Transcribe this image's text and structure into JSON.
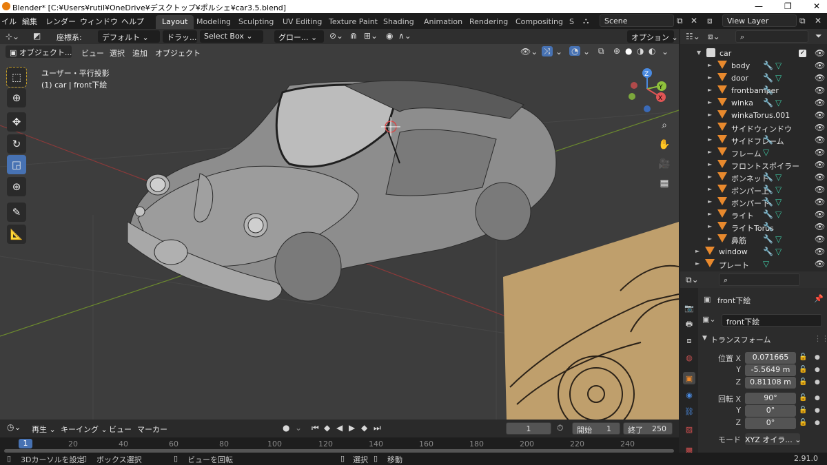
{
  "titlebar": {
    "title": "Blender* [C:¥Users¥rutil¥OneDrive¥デスクトップ¥ポルシェ¥car3.5.blend]"
  },
  "menu": [
    "イル",
    "編集",
    "レンダー",
    "ウィンドウ",
    "ヘルプ"
  ],
  "workspaces": [
    "Layout",
    "Modeling",
    "Sculpting",
    "UV Editing",
    "Texture Paint",
    "Shading",
    "Animation",
    "Rendering",
    "Compositing",
    "S"
  ],
  "scene": {
    "label": "Scene"
  },
  "view_layer": {
    "label": "View Layer"
  },
  "tool_header": {
    "coord_label": "座標系:",
    "orient": "デフォルト",
    "drag": "ドラッ...",
    "select_box": "Select Box",
    "pivot": "グロー...",
    "options": "オプション"
  },
  "viewport_header": {
    "mode": "オブジェクト...",
    "items": [
      "ビュー",
      "選択",
      "追加",
      "オブジェクト"
    ]
  },
  "viewport": {
    "info_line1": "ユーザー・平行投影",
    "info_line2": "(1) car | front下絵"
  },
  "gizmo": {
    "z": "Z",
    "y": "Y",
    "x": "X"
  },
  "outliner": {
    "collection": "car",
    "items": [
      {
        "name": "body",
        "icons": "wv"
      },
      {
        "name": "door",
        "icons": "wv"
      },
      {
        "name": "frontbamper",
        "icons": "w"
      },
      {
        "name": "winka",
        "icons": "wv"
      },
      {
        "name": "winkaTorus.001",
        "icons": ""
      },
      {
        "name": "サイドウィンドウ",
        "icons": ""
      },
      {
        "name": "サイドフレーム",
        "icons": "w"
      },
      {
        "name": "フレーム",
        "icons": "v"
      },
      {
        "name": "フロントスポイラー",
        "icons": ""
      },
      {
        "name": "ボンネット",
        "icons": "wv"
      },
      {
        "name": "ボンパー上",
        "icons": "wv"
      },
      {
        "name": "ボンパー下",
        "icons": "wv"
      },
      {
        "name": "ライト",
        "icons": "wv"
      },
      {
        "name": "ライトTorus",
        "icons": "w"
      },
      {
        "name": "鼻筋",
        "icons": "wv"
      }
    ],
    "root_items": [
      {
        "name": "window",
        "icons": "wv"
      },
      {
        "name": "プレート",
        "icons": "v"
      }
    ]
  },
  "properties": {
    "object_name": "front下絵",
    "data_name": "front下絵",
    "panel_title": "トランスフォーム",
    "location_label": "位置 X",
    "location": [
      "0.071665",
      "-5.5649 m",
      "0.81108 m"
    ],
    "rotation_label": "回転 X",
    "rotation": [
      "90°",
      "0°",
      "0°"
    ],
    "axis_y": "Y",
    "axis_z": "Z",
    "mode_label": "モード",
    "mode_value": "XYZ オイラ..."
  },
  "timeline": {
    "menu": [
      "再生",
      "キーイング",
      "ビュー",
      "マーカー"
    ],
    "current_frame": "1",
    "start_label": "開始",
    "start": "1",
    "end_label": "終了",
    "end": "250",
    "ruler": [
      "1",
      "20",
      "40",
      "60",
      "80",
      "100",
      "120",
      "140",
      "160",
      "180",
      "200",
      "220",
      "240"
    ]
  },
  "statusbar": {
    "items": [
      "3Dカーソルを設定",
      "ボックス選択",
      "ビューを回転",
      "選択",
      "移動"
    ],
    "version": "2.91.0"
  }
}
